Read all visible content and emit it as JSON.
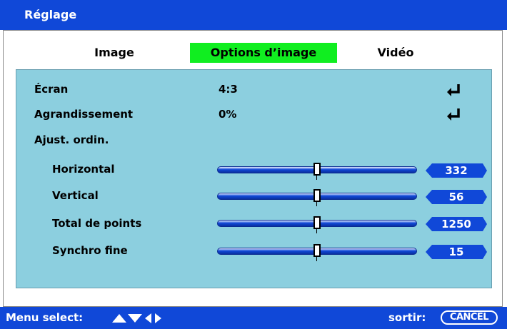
{
  "window": {
    "title": "Réglage"
  },
  "tabs": [
    {
      "label": "Image",
      "active": false
    },
    {
      "label": "Options d’image",
      "active": true
    },
    {
      "label": "Vidéo",
      "active": false
    }
  ],
  "rows": [
    {
      "label": "Écran",
      "value": "4:3",
      "action_icon": "enter-icon"
    },
    {
      "label": "Agrandissement",
      "value": "0%",
      "action_icon": "enter-icon"
    },
    {
      "label": "Ajust. ordin."
    }
  ],
  "sliders": [
    {
      "label": "Horizontal",
      "value": "332",
      "level": 0.5
    },
    {
      "label": "Vertical",
      "value": "56",
      "level": 0.5
    },
    {
      "label": "Total de points",
      "value": "1250",
      "level": 0.5
    },
    {
      "label": "Synchro fine",
      "value": "15",
      "level": 0.5
    }
  ],
  "footer": {
    "menu_select_label": "Menu select:",
    "nav_icons": [
      "up-arrow-icon",
      "down-arrow-icon",
      "left-arrow-icon",
      "right-arrow-icon"
    ],
    "exit_label": "sortir:",
    "cancel_label": "CANCEL"
  },
  "colors": {
    "title_bar": "#1048d8",
    "active_tab": "#10ee20",
    "panel": "#8ccfdf",
    "value_badge": "#1048d8"
  }
}
